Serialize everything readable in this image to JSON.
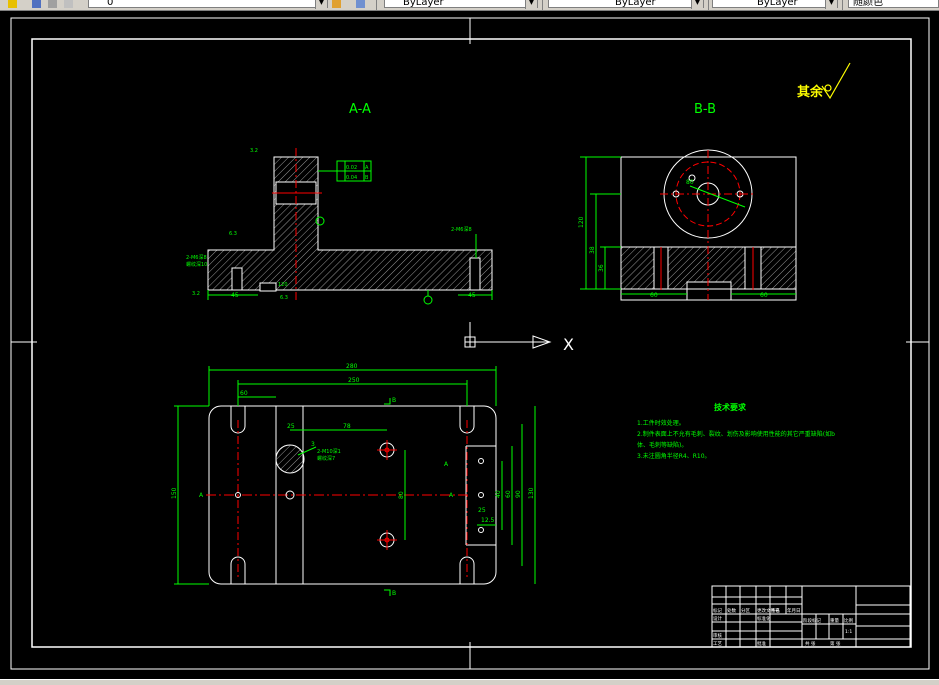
{
  "toolbar": {
    "layer_value": "0",
    "color_value": "ByLayer",
    "linetype_value": "ByLayer",
    "lineweight_value": "ByLayer",
    "plotstyle_value": "随颜色"
  },
  "drawing": {
    "section_aa": "A-A",
    "section_bb": "B-B",
    "surface_finish_label": "其余",
    "tech_title": "技术要求",
    "tech_lines": [
      "1.工件时效处理。",
      "2.制件表面上不允有毛刺、裂纹、划伤及影响使用性能的其它严重缺陷(如b",
      "体、毛刺等缺陷)。",
      "3.未注圆角半径R4、R10。"
    ],
    "axis_x_label": "X",
    "dims_plan": {
      "overall_width": "280",
      "hole_span": "250",
      "left_offset": "60",
      "d25": "25",
      "d78": "78",
      "d3": "3",
      "height_150": "150",
      "right_130": "130",
      "right_90": "90",
      "right_60": "60",
      "right_40": "40",
      "right_25": "25",
      "right_12_5": "12.5",
      "center_80": "80",
      "thread_note_1": "2-M10深1",
      "thread_note_2": "螺纹深7",
      "cut_a": "A",
      "cut_b": "B"
    },
    "dims_aa": {
      "tol_1": "0.02",
      "tol_2": "0.04",
      "ref_a": "A",
      "ref_b": "B",
      "left_45": "45",
      "right_45": "45",
      "d120": "120",
      "thread_left_1": "2-M6深8",
      "thread_left_2": "螺纹深10",
      "thread_right": "2-M6深8",
      "rough_1": "3.2",
      "rough_2": "6.3",
      "rough_3": "3.2",
      "rough_4": "6.3"
    },
    "dims_bb": {
      "d120": "120",
      "d38": "38",
      "d36": "36",
      "d60_left": "60",
      "d60_right": "60",
      "d80": "80",
      "dia_60": "φ60"
    },
    "title_block": {
      "cell_1": "标记",
      "cell_2": "处数",
      "cell_3": "分区",
      "cell_4": "更改文件号",
      "cell_5": "签名",
      "cell_6": "年月日",
      "designer": "设计",
      "standard": "标准化",
      "checker": "审核",
      "process": "工艺",
      "approve": "批准",
      "stage": "阶段标记",
      "weight": "重量",
      "scale": "比例",
      "scale_value": "1:1",
      "sheet_total": "共 张",
      "sheet_no": "第 张"
    }
  }
}
